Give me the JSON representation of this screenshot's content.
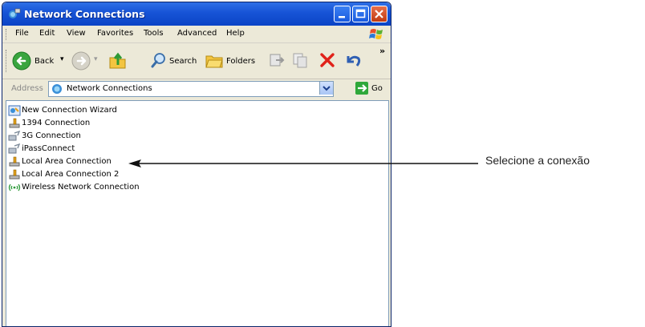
{
  "window": {
    "title": "Network Connections"
  },
  "menubar": {
    "items": [
      "File",
      "Edit",
      "View",
      "Favorites",
      "Tools",
      "Advanced",
      "Help"
    ]
  },
  "toolbar": {
    "back_label": "Back",
    "search_label": "Search",
    "folders_label": "Folders",
    "overflow": "»"
  },
  "addressbar": {
    "label": "Address",
    "value": "Network Connections",
    "go_label": "Go"
  },
  "connections": [
    {
      "label": "New Connection Wizard",
      "icon": "wizard-icon"
    },
    {
      "label": "1394 Connection",
      "icon": "network-connection-icon"
    },
    {
      "label": "3G Connection",
      "icon": "dialup-connection-icon"
    },
    {
      "label": "iPassConnect",
      "icon": "dialup-connection-icon"
    },
    {
      "label": "Local Area Connection",
      "icon": "network-connection-icon"
    },
    {
      "label": "Local Area Connection 2",
      "icon": "network-connection-icon"
    },
    {
      "label": "Wireless Network Connection",
      "icon": "wireless-icon"
    }
  ],
  "annotation": {
    "text": "Selecione a conexão"
  },
  "colors": {
    "titlebar": "#0b44c6",
    "close_button": "#c03b12",
    "window_frame": "#ece9d8"
  }
}
